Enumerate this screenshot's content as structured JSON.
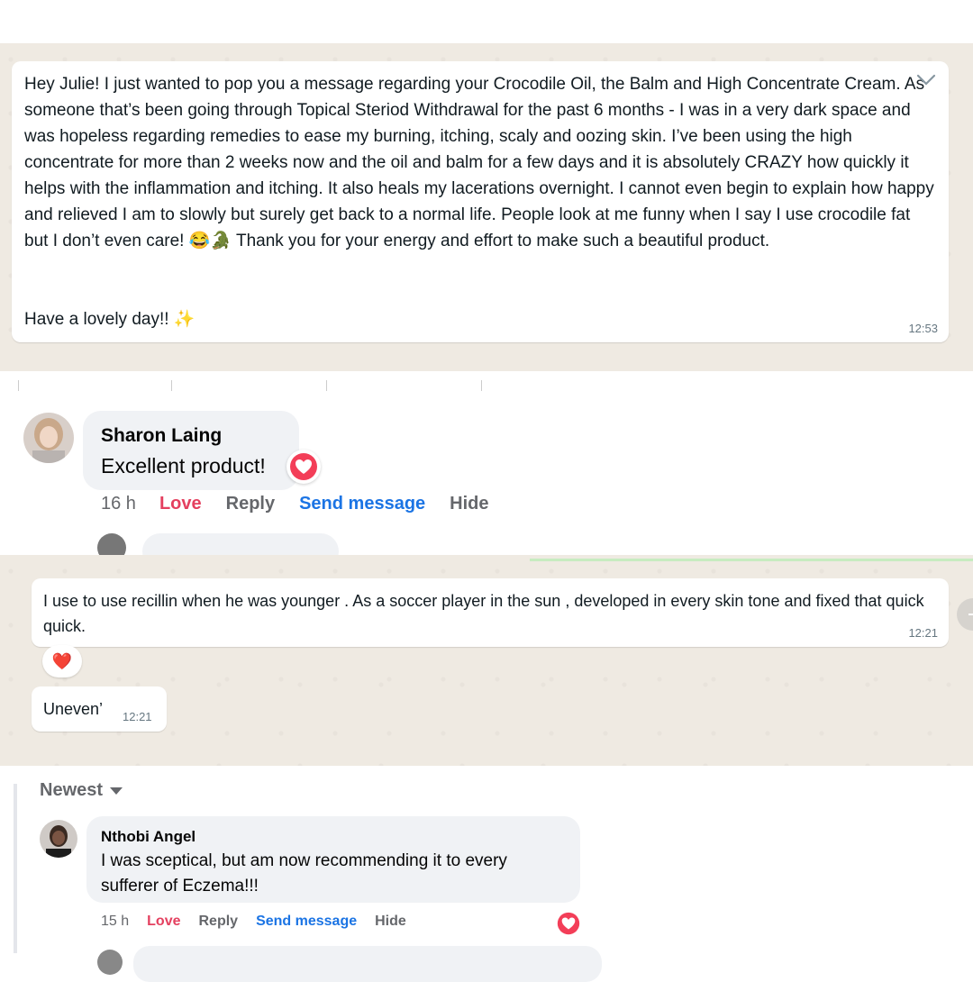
{
  "message1": {
    "paragraph": "Hey Julie! I just wanted to pop you a message regarding your Crocodile Oil, the Balm and High Concentrate Cream. As someone that’s been going through Topical Steriod Withdrawal for the past 6 months - I was in a very dark space and was hopeless regarding remedies to ease my burning, itching, scaly and oozing skin. I’ve been using the high concentrate for more than 2 weeks now and the oil and balm for a few days and it is absolutely CRAZY how quickly it helps with the inflammation and itching. It also heals my lacerations overnight. I cannot even begin to explain how happy and relieved I am to slowly but surely get back to a normal life. People look at me funny when I say I use crocodile fat but I don’t even care! 😂🐊 Thank you for your energy and effort to make such a beautiful product.",
    "signoff": "Have a lovely day!! ✨",
    "time": "12:53"
  },
  "comment1": {
    "name": "Sharon Laing",
    "text": "Excellent product!",
    "time": "16 h",
    "love": "Love",
    "reply": "Reply",
    "send": "Send message",
    "hide": "Hide"
  },
  "message2": {
    "text": "I use to use recillin when he was younger . As a soccer player in the sun , developed in every skin tone and fixed that quick quick.",
    "time": "12:21",
    "reaction": "❤️"
  },
  "message3": {
    "text": "Uneven’",
    "time": "12:21"
  },
  "comments2": {
    "sort_label": "Newest",
    "name": "Nthobi Angel",
    "text": "I was sceptical, but am now recommending it to every sufferer of Eczema!!!",
    "time": "15 h",
    "love": "Love",
    "reply": "Reply",
    "send": "Send message",
    "hide": "Hide"
  },
  "colors": {
    "whatsapp_bg": "#efeae2",
    "love_red": "#e4405f",
    "link_blue": "#1b74e4",
    "meta_grey": "#65676b"
  }
}
